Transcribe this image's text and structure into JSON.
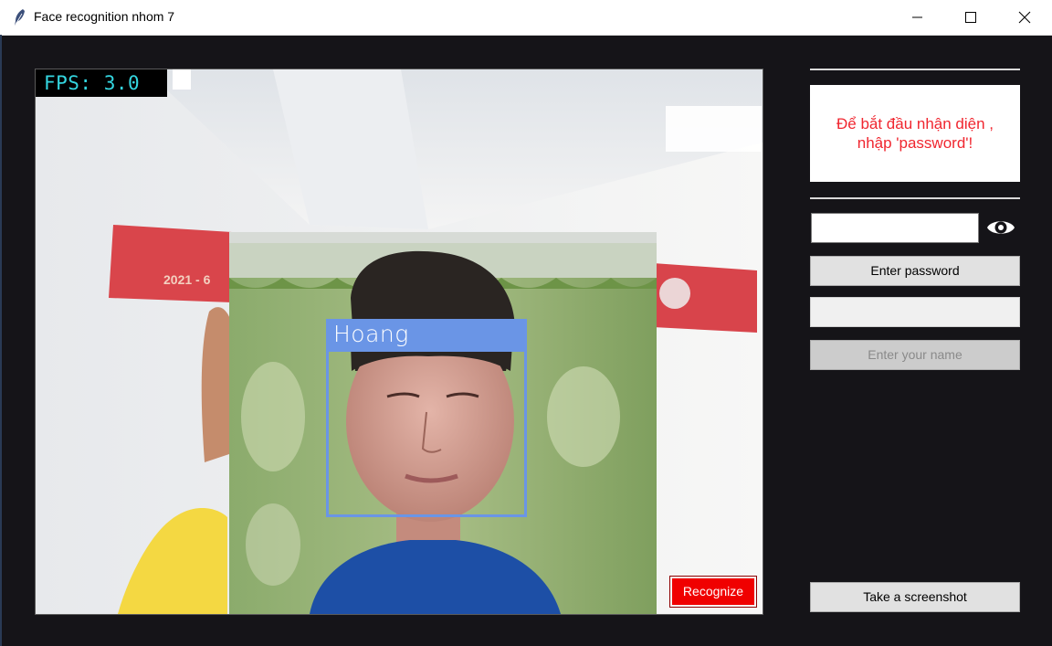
{
  "window": {
    "title": "Face recognition nhom 7",
    "controls": [
      "minimize-icon",
      "maximize-icon",
      "close-icon"
    ]
  },
  "video": {
    "fps_text": "FPS: 3.0",
    "detected_name": "Hoang",
    "box_color": "#6a95e6",
    "fps_color": "#34d6e0"
  },
  "buttons": {
    "recognize": "Recognize",
    "enter_password": "Enter password",
    "enter_name": "Enter your name",
    "screenshot": "Take a screenshot"
  },
  "panel": {
    "message": "Để bắt đầu nhận diện , nhập 'password'!",
    "message_color": "#f0262f",
    "password_value": "",
    "name_value": "",
    "eye_icon": "eye-icon"
  },
  "colors": {
    "background": "#151418",
    "recognize_bg": "#f00000"
  }
}
